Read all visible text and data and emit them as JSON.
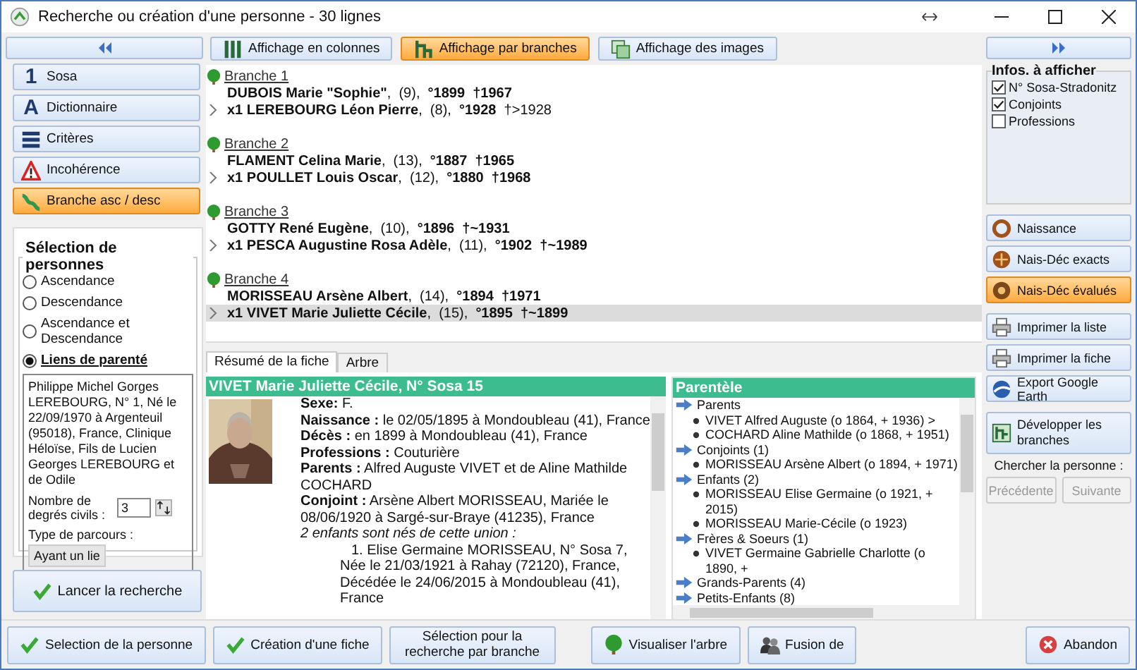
{
  "window": {
    "title": "Recherche ou création d'une personne - 30 lignes"
  },
  "left_panel": {
    "nav": [
      {
        "label": "Sosa",
        "glyph": "1",
        "selected": false
      },
      {
        "label": "Dictionnaire",
        "glyph": "A",
        "selected": false
      },
      {
        "label": "Critères",
        "selected": false
      },
      {
        "label": "Incohérence",
        "selected": false
      },
      {
        "label": "Branche asc / desc",
        "selected": true
      }
    ],
    "selection": {
      "title": "Sélection de personnes",
      "options": [
        {
          "label": "Ascendance",
          "selected": false
        },
        {
          "label": "Descendance",
          "selected": false
        },
        {
          "label": "Ascendance et Descendance",
          "selected": false
        },
        {
          "label": "Liens de parenté",
          "selected": true
        }
      ],
      "info": "Philippe Michel Gorges LEREBOURG, N° 1, Né le 22/09/1970 à Argenteuil (95018), France, Clinique Héloïse, Fils de Lucien Georges LEREBOURG et de Odile",
      "degrees_label": "Nombre de degrés civils :",
      "degrees_value": "3",
      "route_label": "Type de parcours :",
      "route_value": "Ayant un lie"
    },
    "launch_button": "Lancer la recherche"
  },
  "view_buttons": [
    {
      "label": "Affichage en colonnes",
      "selected": false
    },
    {
      "label": "Affichage par branches",
      "selected": true
    },
    {
      "label": "Affichage des images",
      "selected": false
    }
  ],
  "branches": [
    {
      "title": "Branche 1",
      "people": [
        {
          "text": "**DUBOIS Marie \"Sophie\"**,  (9),  **°1899  †1967**",
          "spouse": false,
          "selected": false
        },
        {
          "text": "**x1 LEREBOURG Léon Pierre**,  (8),  **°1928**  †>1928",
          "spouse": true,
          "selected": false
        }
      ]
    },
    {
      "title": "Branche 2",
      "people": [
        {
          "text": "**FLAMENT Celina Marie**,  (13),  **°1887  †1965**",
          "spouse": false,
          "selected": false
        },
        {
          "text": "**x1 POULLET Louis Oscar**,  (12),  **°1880  †1968**",
          "spouse": true,
          "selected": false
        }
      ]
    },
    {
      "title": "Branche 3",
      "people": [
        {
          "text": "**GOTTY René Eugène**,  (10),  **°1896  †~1931**",
          "spouse": false,
          "selected": false
        },
        {
          "text": "**x1 PESCA Augustine Rosa Adèle**,  (11),  **°1902  †~1989**",
          "spouse": true,
          "selected": false
        }
      ]
    },
    {
      "title": "Branche 4",
      "people": [
        {
          "text": "**MORISSEAU Arsène Albert**,  (14),  **°1894  †1971**",
          "spouse": false,
          "selected": false
        },
        {
          "text": "**x1 VIVET Marie Juliette Cécile**,  (15),  **°1895  †~1899**",
          "spouse": true,
          "selected": true
        }
      ]
    }
  ],
  "detail_tabs": [
    {
      "label": "Résumé de la fiche",
      "selected": true
    },
    {
      "label": "Arbre",
      "selected": false
    }
  ],
  "fiche": {
    "title": "VIVET Marie Juliette Cécile, N° Sosa 15",
    "lines": [
      {
        "text": "**Sexe:** F.",
        "kind": "field"
      },
      {
        "text": "**Naissance :** le 02/05/1895 à Mondoubleau (41), France",
        "kind": "field"
      },
      {
        "text": "**Décès :** en 1899 à Mondoubleau (41), France",
        "kind": "field"
      },
      {
        "text": "**Professions :** Couturière",
        "kind": "field"
      },
      {
        "text": "**Parents :** Alfred Auguste VIVET et de Aline Mathilde COCHARD",
        "kind": "field"
      },
      {
        "text": "**Conjoint :** Arsène Albert MORISSEAU, Mariée le 08/06/1920 à Sargé-sur-Braye (41235), France",
        "kind": "field"
      },
      {
        "text": "2 enfants sont nés de cette union :",
        "kind": "italic"
      },
      {
        "text": "1. Elise Germaine MORISSEAU, N° Sosa 7, Née le 21/03/1921 à Rahay (72120), France, Décédée le 24/06/2015 à Mondoubleau (41), France",
        "kind": "child"
      }
    ]
  },
  "parentele": {
    "title": "Parentèle",
    "groups": [
      {
        "label": "Parents",
        "children": [
          {
            "label": "VIVET Alfred Auguste (o  1864, +  1936)   >"
          },
          {
            "label": "COCHARD Aline Mathilde (o  1868, +  1951)"
          }
        ]
      },
      {
        "label": "Conjoints (1)",
        "children": [
          {
            "label": "MORISSEAU Arsène Albert (o  1894, +  1971)"
          }
        ]
      },
      {
        "label": "Enfants (2)",
        "children": [
          {
            "label": "MORISSEAU Elise Germaine (o  1921, +  2015)"
          },
          {
            "label": "MORISSEAU Marie-Cécile (o  1923)"
          }
        ]
      },
      {
        "label": "Frères & Soeurs (1)",
        "children": [
          {
            "label": "VIVET Germaine Gabrielle Charlotte (o  1890, +"
          }
        ]
      },
      {
        "label": "Grands-Parents (4)"
      },
      {
        "label": "Petits-Enfants (8)"
      }
    ]
  },
  "right_panel": {
    "options": {
      "title": "Infos. à afficher",
      "items": [
        {
          "label": "N° Sosa-Stradonitz",
          "checked": true
        },
        {
          "label": "Conjoints",
          "checked": true
        },
        {
          "label": "Professions",
          "checked": false
        }
      ]
    },
    "modes": [
      {
        "label": "Naissance",
        "selected": false
      },
      {
        "label": "Nais-Déc exacts",
        "selected": false
      },
      {
        "label": "Nais-Déc évalués",
        "selected": true
      }
    ],
    "actions": [
      {
        "label": "Imprimer la liste"
      },
      {
        "label": "Imprimer la fiche"
      },
      {
        "label": "Export Google Earth"
      }
    ],
    "expand_button": "Développer les branches",
    "find_label": "Chercher la personne :",
    "nav_buttons": [
      {
        "label": "Précédente",
        "disabled": true
      },
      {
        "label": "Suivante",
        "disabled": true
      }
    ]
  },
  "bottom_buttons": [
    {
      "label": "Selection de la personne"
    },
    {
      "label": "Création d'une fiche"
    },
    {
      "label": "Sélection pour la recherche par branche"
    },
    {
      "label": "Visualiser l'arbre"
    },
    {
      "label": "Fusion de"
    }
  ],
  "abandon_button": "Abandon"
}
